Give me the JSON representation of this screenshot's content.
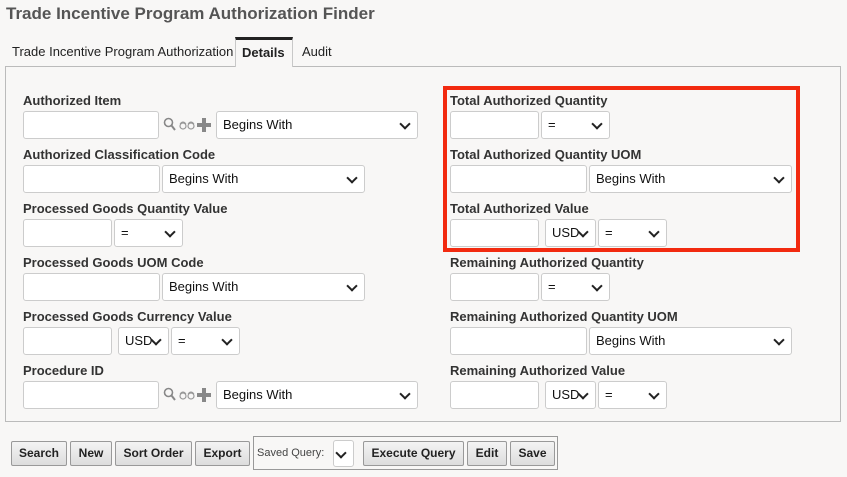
{
  "title": "Trade Incentive Program Authorization Finder",
  "tabs": [
    {
      "label": "Trade Incentive Program Authorization"
    },
    {
      "label": "Details"
    },
    {
      "label": "Audit"
    }
  ],
  "fields": [
    {
      "label": "Authorized Item",
      "type": "lookup",
      "value": "",
      "operator": "Begins With"
    },
    {
      "label": "Authorized Classification Code",
      "type": "text",
      "value": "",
      "operator": "Begins With"
    },
    {
      "label": "Processed Goods Quantity Value",
      "type": "num",
      "value": "",
      "operator": "="
    },
    {
      "label": "Processed Goods UOM Code",
      "type": "text",
      "value": "",
      "operator": "Begins With"
    },
    {
      "label": "Processed Goods Currency Value",
      "type": "currency",
      "value": "",
      "currency": "USD",
      "operator": "="
    },
    {
      "label": "Procedure ID",
      "type": "lookup",
      "value": "",
      "operator": "Begins With"
    },
    {
      "label": "Total Authorized Quantity",
      "type": "num",
      "value": "",
      "operator": "="
    },
    {
      "label": "Total Authorized Quantity UOM",
      "type": "text",
      "value": "",
      "operator": "Begins With"
    },
    {
      "label": "Total Authorized Value",
      "type": "currency",
      "value": "",
      "currency": "USD",
      "operator": "="
    },
    {
      "label": "Remaining Authorized Quantity",
      "type": "num",
      "value": "",
      "operator": "="
    },
    {
      "label": "Remaining Authorized Quantity UOM",
      "type": "text",
      "value": "",
      "operator": "Begins With"
    },
    {
      "label": "Remaining Authorized Value",
      "type": "currency",
      "value": "",
      "currency": "USD",
      "operator": "="
    }
  ],
  "buttons": {
    "search": "Search",
    "new": "New",
    "sort_order": "Sort Order",
    "export": "Export",
    "execute_query": "Execute Query",
    "edit": "Edit",
    "save": "Save"
  },
  "saved_query": {
    "label": "Saved Query:",
    "value": ""
  },
  "highlight_color": "#f22a10"
}
